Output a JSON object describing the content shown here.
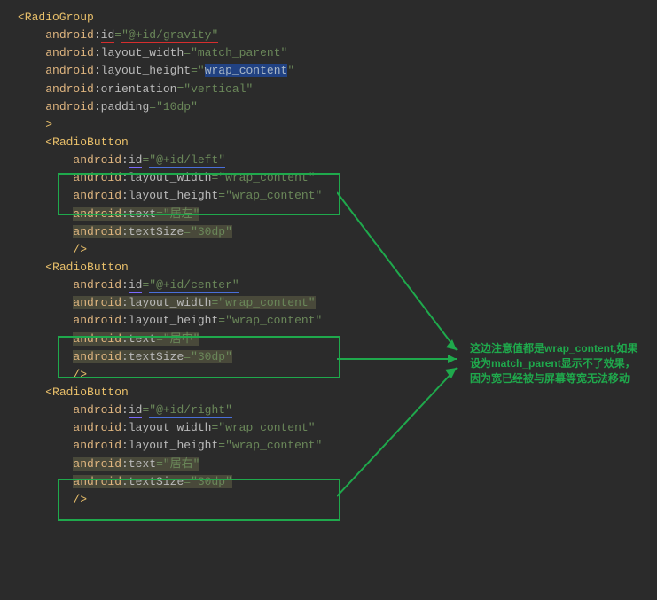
{
  "code": {
    "radiogroup_open": "<RadioGroup",
    "id_attr": "android",
    "id_name": "id",
    "id_val": "\"@+id/gravity\"",
    "lw": "layout_width",
    "lh": "layout_height",
    "match_parent": "\"match_parent\"",
    "wrap_content": "\"wrap_content\"",
    "wrap_content_sel": "wrap_content",
    "orientation": "orientation",
    "vertical": "\"vertical\"",
    "padding": "padding",
    "ten_dp": "\"10dp\"",
    "close_angle": ">",
    "radiobutton_open": "<RadioButton",
    "rb1_id": "\"@+id/left\"",
    "rb2_id": "\"@+id/center\"",
    "rb3_id": "\"@+id/right\"",
    "text_attr": "text",
    "text1": "\"居左\"",
    "text2": "\"居中\"",
    "text3": "\"居右\"",
    "textsize_attr": "textSize",
    "textsize_val": "\"30dp\"",
    "self_close": "/>"
  },
  "annotation": {
    "line1": "这边注意值都是wrap_content,如果",
    "line2": "设为match_parent显示不了效果，",
    "line3": "因为宽已经被与屏幕等宽无法移动"
  }
}
